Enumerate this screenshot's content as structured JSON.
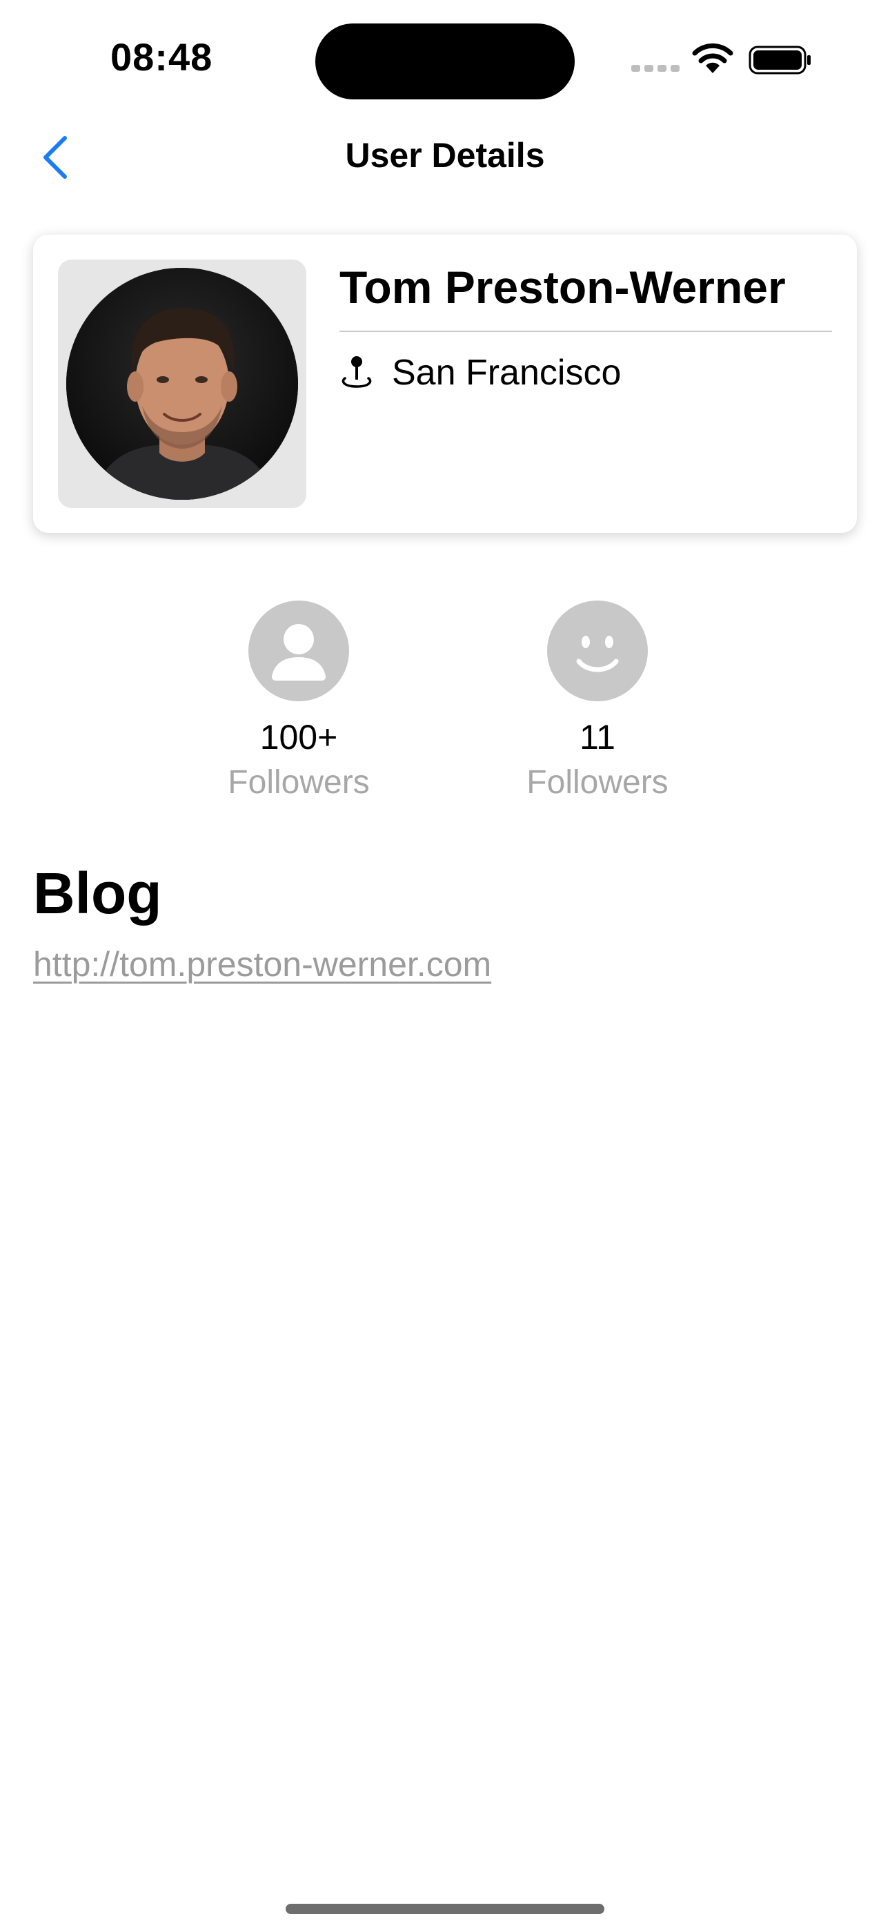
{
  "status_bar": {
    "time": "08:48"
  },
  "nav": {
    "title": "User Details",
    "back_icon": "chevron-left-icon",
    "accent_color": "#1a7cf5"
  },
  "profile": {
    "name": "Tom Preston-Werner",
    "location": "San Francisco",
    "location_icon": "map-pin-icon"
  },
  "stats": [
    {
      "count": "100+",
      "label": "Followers",
      "icon": "person-icon"
    },
    {
      "count": "11",
      "label": "Followers",
      "icon": "smiley-face-icon"
    }
  ],
  "blog": {
    "heading": "Blog",
    "url": "http://tom.preston-werner.com"
  }
}
